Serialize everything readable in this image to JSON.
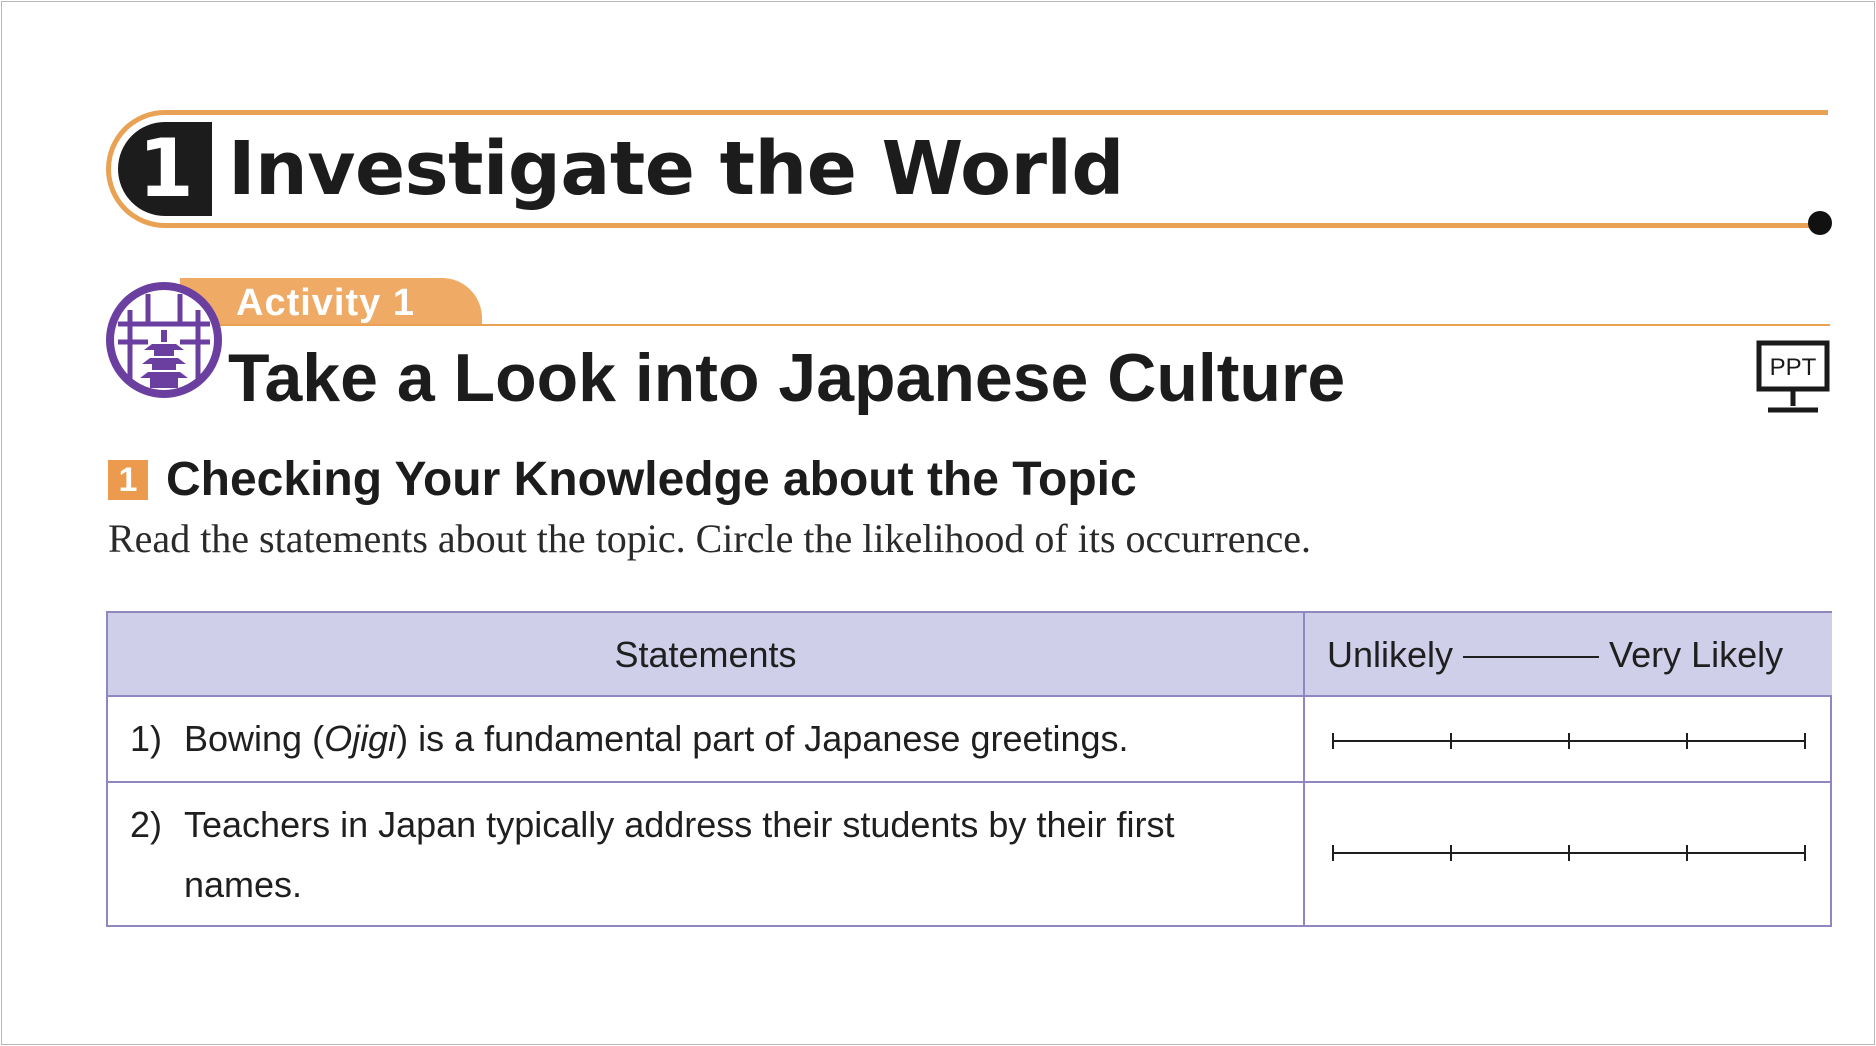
{
  "unit": {
    "number": "1",
    "title": "Investigate the World"
  },
  "activity": {
    "label": "Activity 1",
    "title": "Take a Look into Japanese Culture",
    "ppt_label": "PPT",
    "icon": "pagoda-icon"
  },
  "section": {
    "number": "1",
    "title": "Checking Your Knowledge about the Topic",
    "instruction": "Read the statements about the topic. Circle the likelihood of its occurrence."
  },
  "table": {
    "header_statements": "Statements",
    "scale_low": "Unlikely",
    "scale_high": "Very Likely",
    "scale_points": 5,
    "rows": [
      {
        "num": "1)",
        "before": "Bowing (",
        "italic": "Ojigi",
        "after": ") is a fundamental part of Japanese greetings."
      },
      {
        "num": "2)",
        "text": "Teachers in Japan typically address their students by their first names."
      }
    ]
  },
  "colors": {
    "accent_orange": "#e9a154",
    "tab_orange": "#efaa66",
    "icon_purple": "#6b3fa0",
    "table_header": "#d0cfea",
    "table_border": "#8f88c0"
  }
}
